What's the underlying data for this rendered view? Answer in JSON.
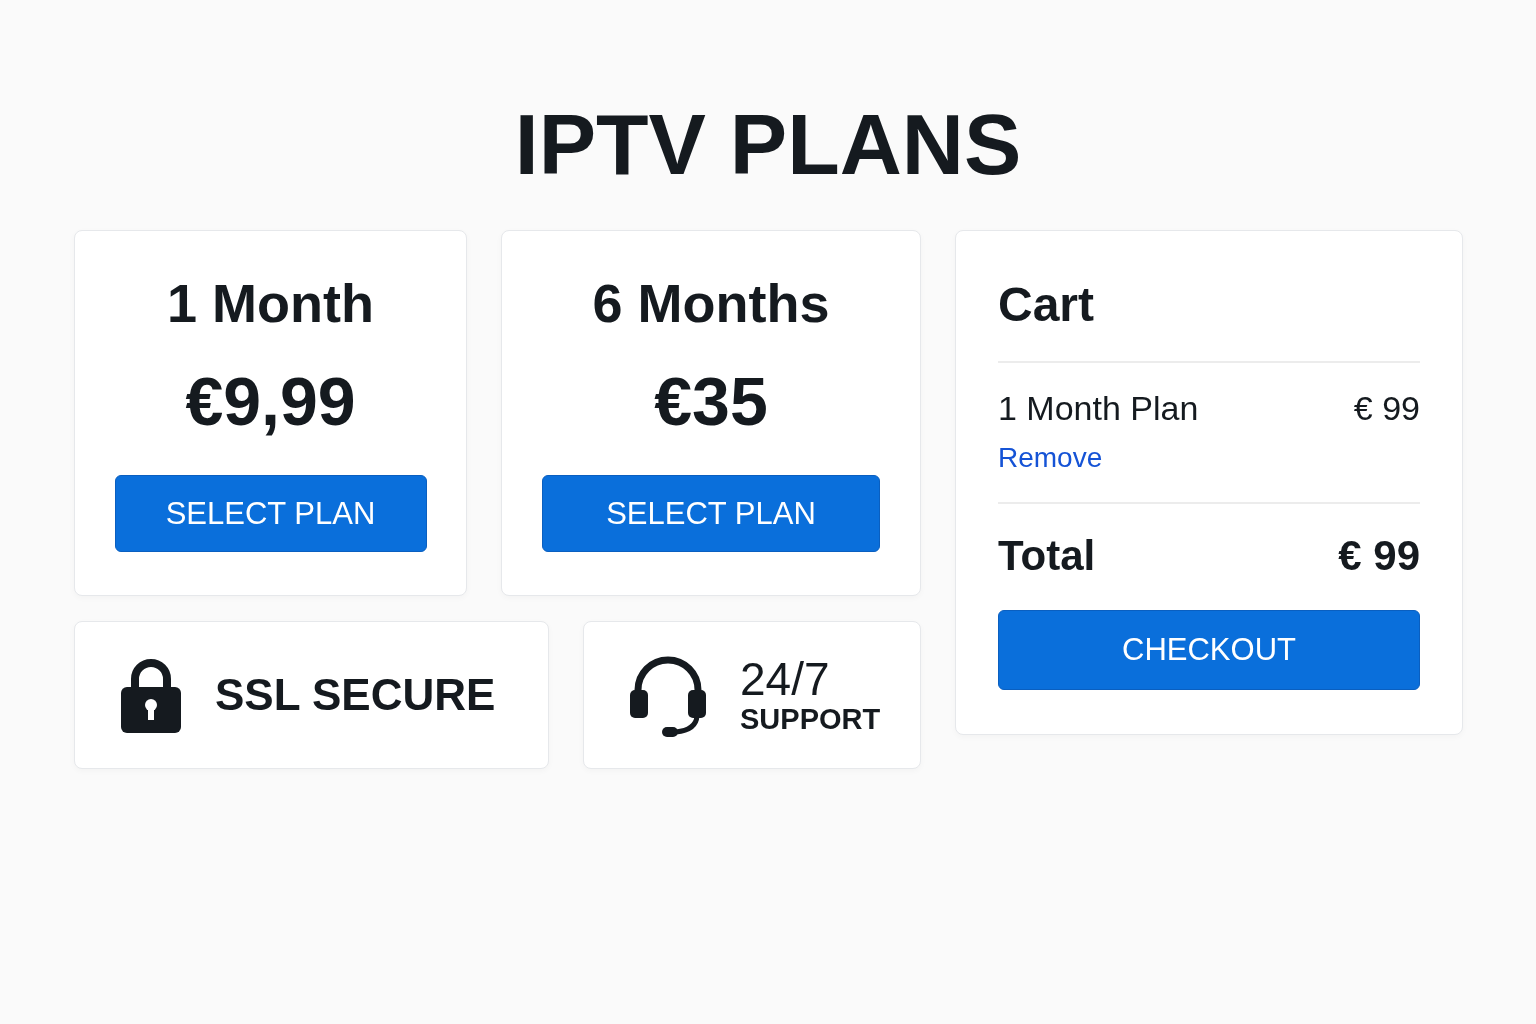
{
  "title": "IPTV PLANS",
  "plans": [
    {
      "name": "1 Month",
      "price": "€9,99",
      "button": "SELECT PLAN"
    },
    {
      "name": "6 Months",
      "price": "€35",
      "button": "SELECT PLAN"
    }
  ],
  "features": [
    {
      "kind": "lock",
      "label": "SSL SECURE"
    },
    {
      "kind": "headset",
      "label": "24/7",
      "sublabel": "SUPPORT"
    }
  ],
  "cart": {
    "title": "Cart",
    "items": [
      {
        "name": "1 Month Plan",
        "price": "€ 99",
        "action": "Remove"
      }
    ],
    "total_label": "Total",
    "total": "€ 99",
    "button": "CHECKOUT"
  }
}
